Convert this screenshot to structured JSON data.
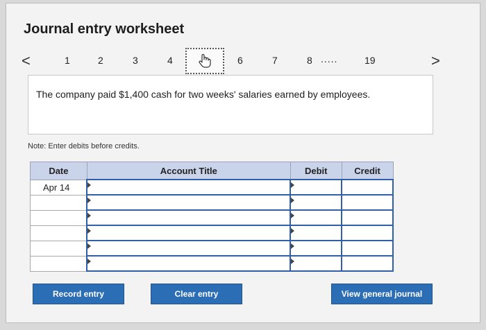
{
  "header": {
    "title": "Journal entry worksheet"
  },
  "pager": {
    "prev_symbol": "<",
    "next_symbol": ">",
    "pages": [
      "1",
      "2",
      "3",
      "4",
      "6",
      "7",
      "8"
    ],
    "ellipsis": ".....",
    "last_page": "19"
  },
  "question": {
    "text": "The company paid $1,400 cash for two weeks' salaries earned by employees."
  },
  "note": "Note: Enter debits before credits.",
  "table": {
    "headers": {
      "date": "Date",
      "account": "Account Title",
      "debit": "Debit",
      "credit": "Credit"
    },
    "rows": [
      {
        "date": "Apr 14"
      },
      {
        "date": ""
      },
      {
        "date": ""
      },
      {
        "date": ""
      },
      {
        "date": ""
      },
      {
        "date": ""
      }
    ]
  },
  "buttons": {
    "record": "Record entry",
    "clear": "Clear entry",
    "view": "View general journal"
  },
  "colors": {
    "button": "#2c6eb5",
    "header_bg": "#c9d3ea",
    "input_border": "#2e5fa8"
  }
}
